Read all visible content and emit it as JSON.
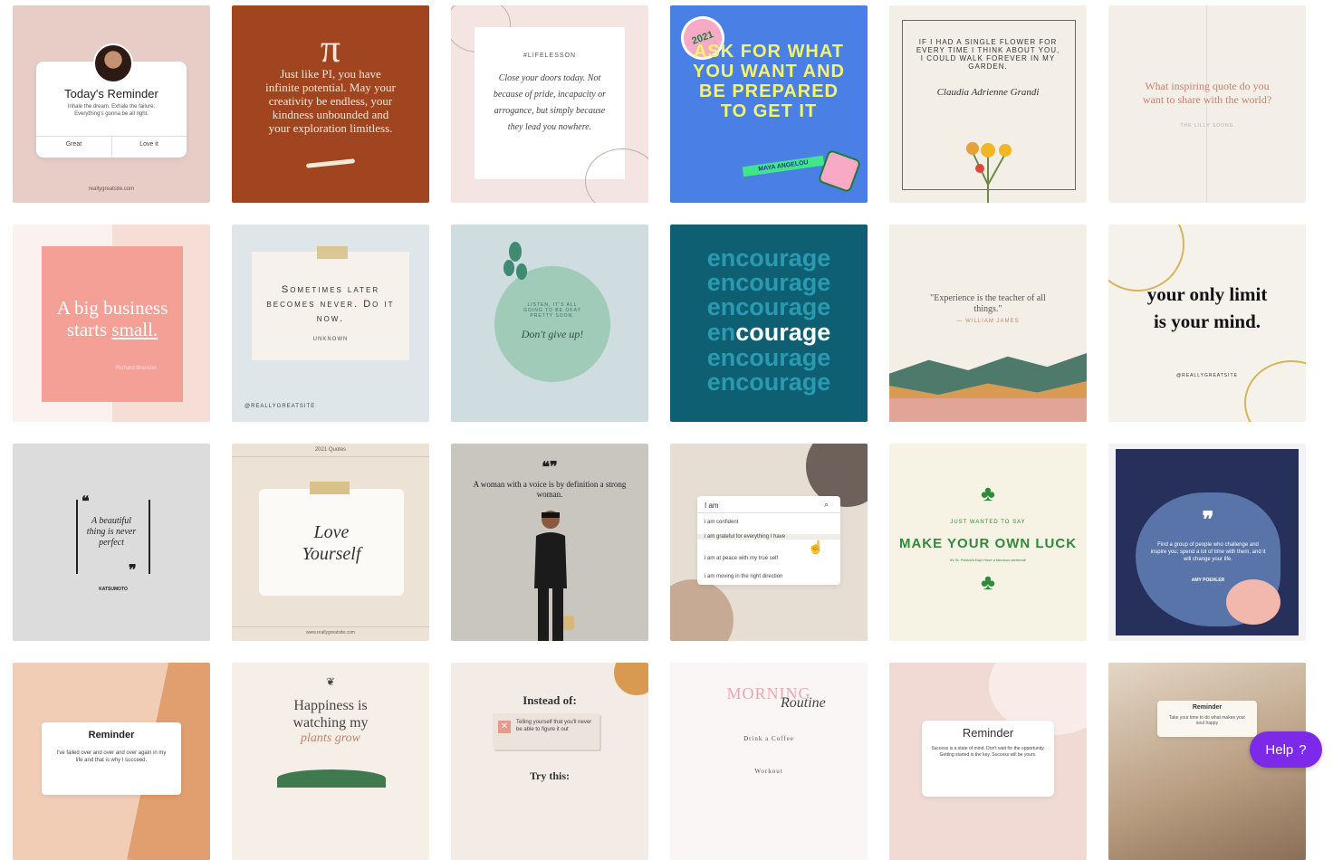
{
  "tiles": {
    "t1": {
      "title": "Today's Reminder",
      "body": "Inhale the dream. Exhale the failure. Everything's gonna be all right.",
      "btn1": "Great",
      "btn2": "Love it",
      "footer": "reallygreatsite.com"
    },
    "t2": {
      "symbol": "π",
      "text": "Just like PI, you have infinite potential. May your creativity be endless, your kindness unbounded and your exploration limitless."
    },
    "t3": {
      "heading": "#LIFELESSON",
      "script": "Close your doors today. Not because of pride, incapacity or arrogance, but simply because they lead you nowhere."
    },
    "t4": {
      "text": "ASK FOR WHAT YOU WANT AND BE PREPARED TO GET IT",
      "badge": "2021",
      "tag": "MAYA ANGELOU"
    },
    "t5": {
      "text": "IF I HAD A SINGLE FLOWER FOR EVERY TIME I THINK ABOUT YOU, I COULD WALK FOREVER IN MY GARDEN.",
      "author": "Claudia Adrienne Grandi"
    },
    "t6": {
      "text": "What inspiring quote do you want to share with the world?",
      "author": "THE LILLY SOONG"
    },
    "t7": {
      "line1": "A big business",
      "line2": "starts",
      "line3": "small.",
      "author": "Richard Branson"
    },
    "t8": {
      "text": "Sometimes later becomes never. Do it now.",
      "author": "UNKNOWN",
      "handle": "@REALLYGREATSITE"
    },
    "t9": {
      "caps": "LISTEN, IT'S ALL GOING TO BE OKAY PRETTY SOON.",
      "script": "Don't give up!"
    },
    "t10": {
      "word": "encourage",
      "lead": "en",
      "rest": "courage"
    },
    "t11": {
      "text": "\"Experience is the teacher of all things.\"",
      "author": "— WILLIAM JAMES"
    },
    "t12": {
      "text": "your only limit is your mind.",
      "handle": "@REALLYGREATSITE"
    },
    "t13": {
      "text": "A beautiful thing is never perfect",
      "author": "KATSUMOTO"
    },
    "t14": {
      "top": "2021 Quotes",
      "script": "Love Yourself",
      "footer": "www.reallygreatsite.com"
    },
    "t15": {
      "text": "A woman with a voice is by definition a strong woman."
    },
    "t16": {
      "search": "I am",
      "options": [
        "i am confident",
        "i am grateful for everything I have",
        "i am at peace with my true self",
        "i am moving in the right direction"
      ]
    },
    "t17": {
      "small": "JUST WANTED TO SAY",
      "text": "MAKE YOUR OWN LUCK",
      "sub": "It's St. Patrick's Day! Have a fabulous weekend!"
    },
    "t18": {
      "text": "Find a group of people who challenge and inspire you; spend a lot of time with them, and it will change your life.",
      "author": "AMY POEHLER"
    },
    "t19": {
      "title": "Reminder",
      "body": "I've failed over and over and over again in my life and that is why I succeed."
    },
    "t20": {
      "text": "Happiness is watching my",
      "script": "plants grow"
    },
    "t21": {
      "title": "Instead of:",
      "body": "Telling yourself that you'll never be able to figure it out",
      "next": "Try this:"
    },
    "t22": {
      "title": "MORNING",
      "script": "Routine",
      "line1": "Drink a Coffee",
      "line2": "Workout"
    },
    "t23": {
      "title": "Reminder",
      "body": "Success is a state of mind. Don't wait for the opportunity. Getting started is the key. Success will be yours."
    },
    "t24": {
      "title": "Reminder",
      "body": "Take your time to do what makes your soul happy"
    }
  },
  "help": {
    "label": "Help",
    "icon": "?"
  },
  "colors": {
    "accent": "#7d2ae8"
  }
}
